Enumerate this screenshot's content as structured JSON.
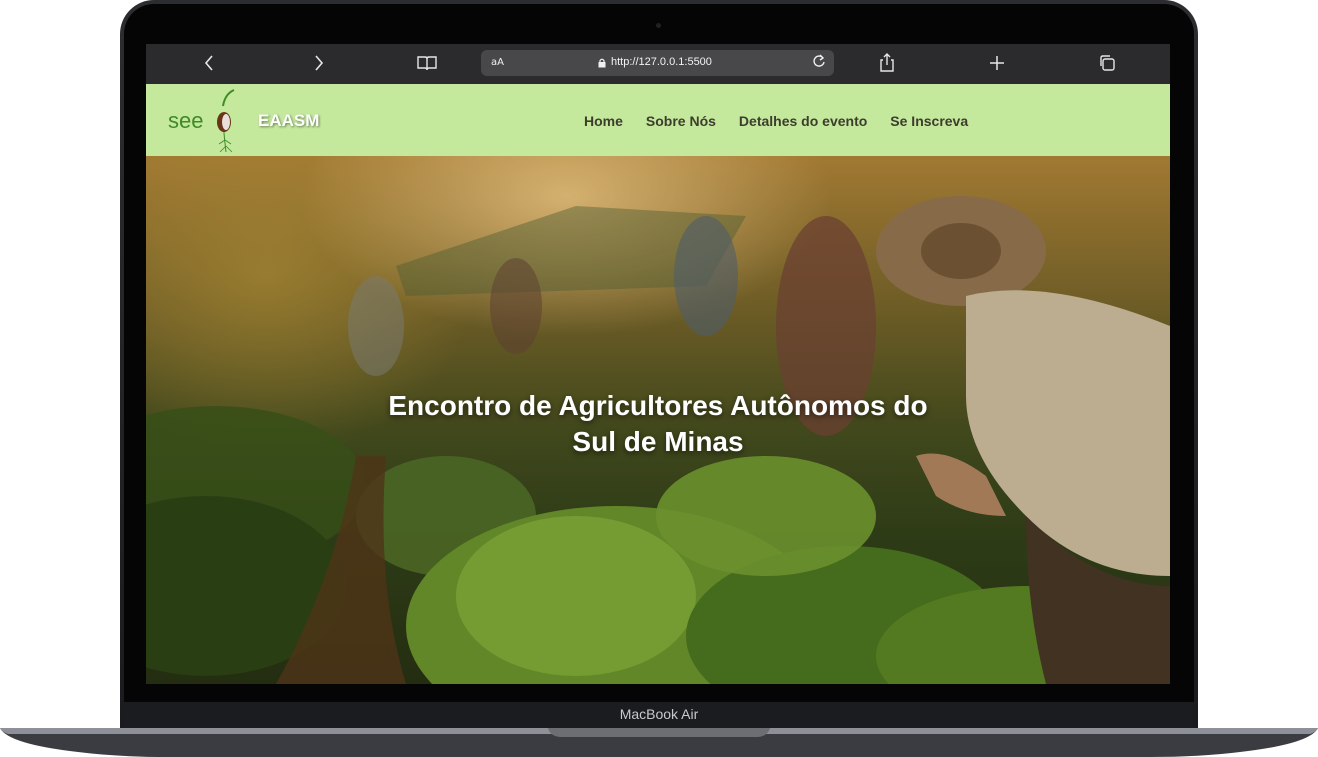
{
  "browser": {
    "url": "http://127.0.0.1:5500",
    "aa_label": "aA"
  },
  "site": {
    "logo_text": "see",
    "brand": "EAASM",
    "nav": [
      {
        "label": "Home"
      },
      {
        "label": "Sobre Nós"
      },
      {
        "label": "Detalhes do evento"
      },
      {
        "label": "Se Inscreva"
      }
    ],
    "hero_title_line1": "Encontro de Agricultores Autônomos do",
    "hero_title_line2": "Sul de Minas"
  },
  "device": {
    "model": "MacBook Air"
  },
  "colors": {
    "nav_bg": "#c4e89c",
    "toolbar_bg": "#2b2b2d",
    "logo_green": "#3e8b27"
  }
}
